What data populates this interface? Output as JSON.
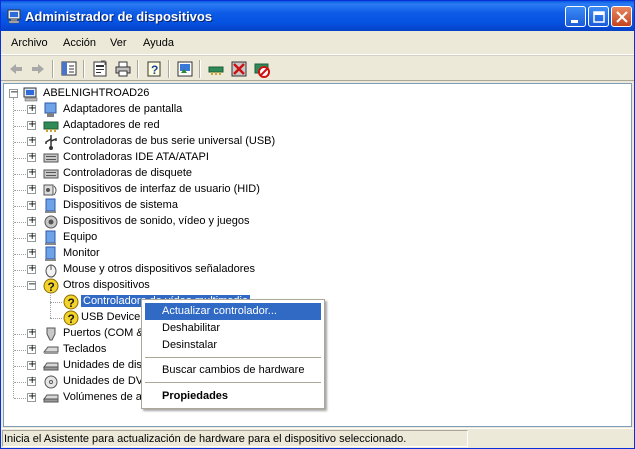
{
  "window": {
    "title": "Administrador de dispositivos"
  },
  "menu": [
    "Archivo",
    "Acción",
    "Ver",
    "Ayuda"
  ],
  "tree": {
    "root": "ABELNIGHTROAD26",
    "items": [
      {
        "label": "Adaptadores de pantalla",
        "icon": "display-adapter-icon"
      },
      {
        "label": "Adaptadores de red",
        "icon": "network-adapter-icon"
      },
      {
        "label": "Controladoras de bus serie universal (USB)",
        "icon": "usb-icon"
      },
      {
        "label": "Controladoras IDE ATA/ATAPI",
        "icon": "ide-controller-icon"
      },
      {
        "label": "Controladoras de disquete",
        "icon": "floppy-controller-icon"
      },
      {
        "label": "Dispositivos de interfaz de usuario (HID)",
        "icon": "hid-icon"
      },
      {
        "label": "Dispositivos de sistema",
        "icon": "system-device-icon"
      },
      {
        "label": "Dispositivos de sonido, vídeo y juegos",
        "icon": "sound-icon"
      },
      {
        "label": "Equipo",
        "icon": "computer-icon"
      },
      {
        "label": "Monitor",
        "icon": "monitor-icon"
      },
      {
        "label": "Mouse y otros dispositivos señaladores",
        "icon": "mouse-icon"
      },
      {
        "label": "Otros dispositivos",
        "icon": "unknown-device-icon"
      },
      {
        "label": "Controladora de vídeo multimedia",
        "icon": "warning-device-icon",
        "child": true,
        "selected": true
      },
      {
        "label": "USB Device",
        "icon": "warning-device-icon",
        "child": true
      },
      {
        "label": "Puertos (COM &",
        "icon": "port-icon"
      },
      {
        "label": "Teclados",
        "icon": "keyboard-icon"
      },
      {
        "label": "Unidades de disco",
        "icon": "disk-drive-icon"
      },
      {
        "label": "Unidades de DVD/CD-ROM",
        "icon": "dvd-drive-icon"
      },
      {
        "label": "Volúmenes de almacenamiento",
        "icon": "storage-volume-icon"
      }
    ]
  },
  "context_menu": {
    "items": [
      "Actualizar controlador...",
      "Deshabilitar",
      "Desinstalar",
      "Buscar cambios de hardware",
      "Propiedades"
    ]
  },
  "status": {
    "text": "Inicia el Asistente para actualización de hardware para el dispositivo seleccionado."
  },
  "colors": {
    "titlebar": "#0A5BE0",
    "selection": "#316AC5",
    "window_bg": "#ECE9D8"
  }
}
